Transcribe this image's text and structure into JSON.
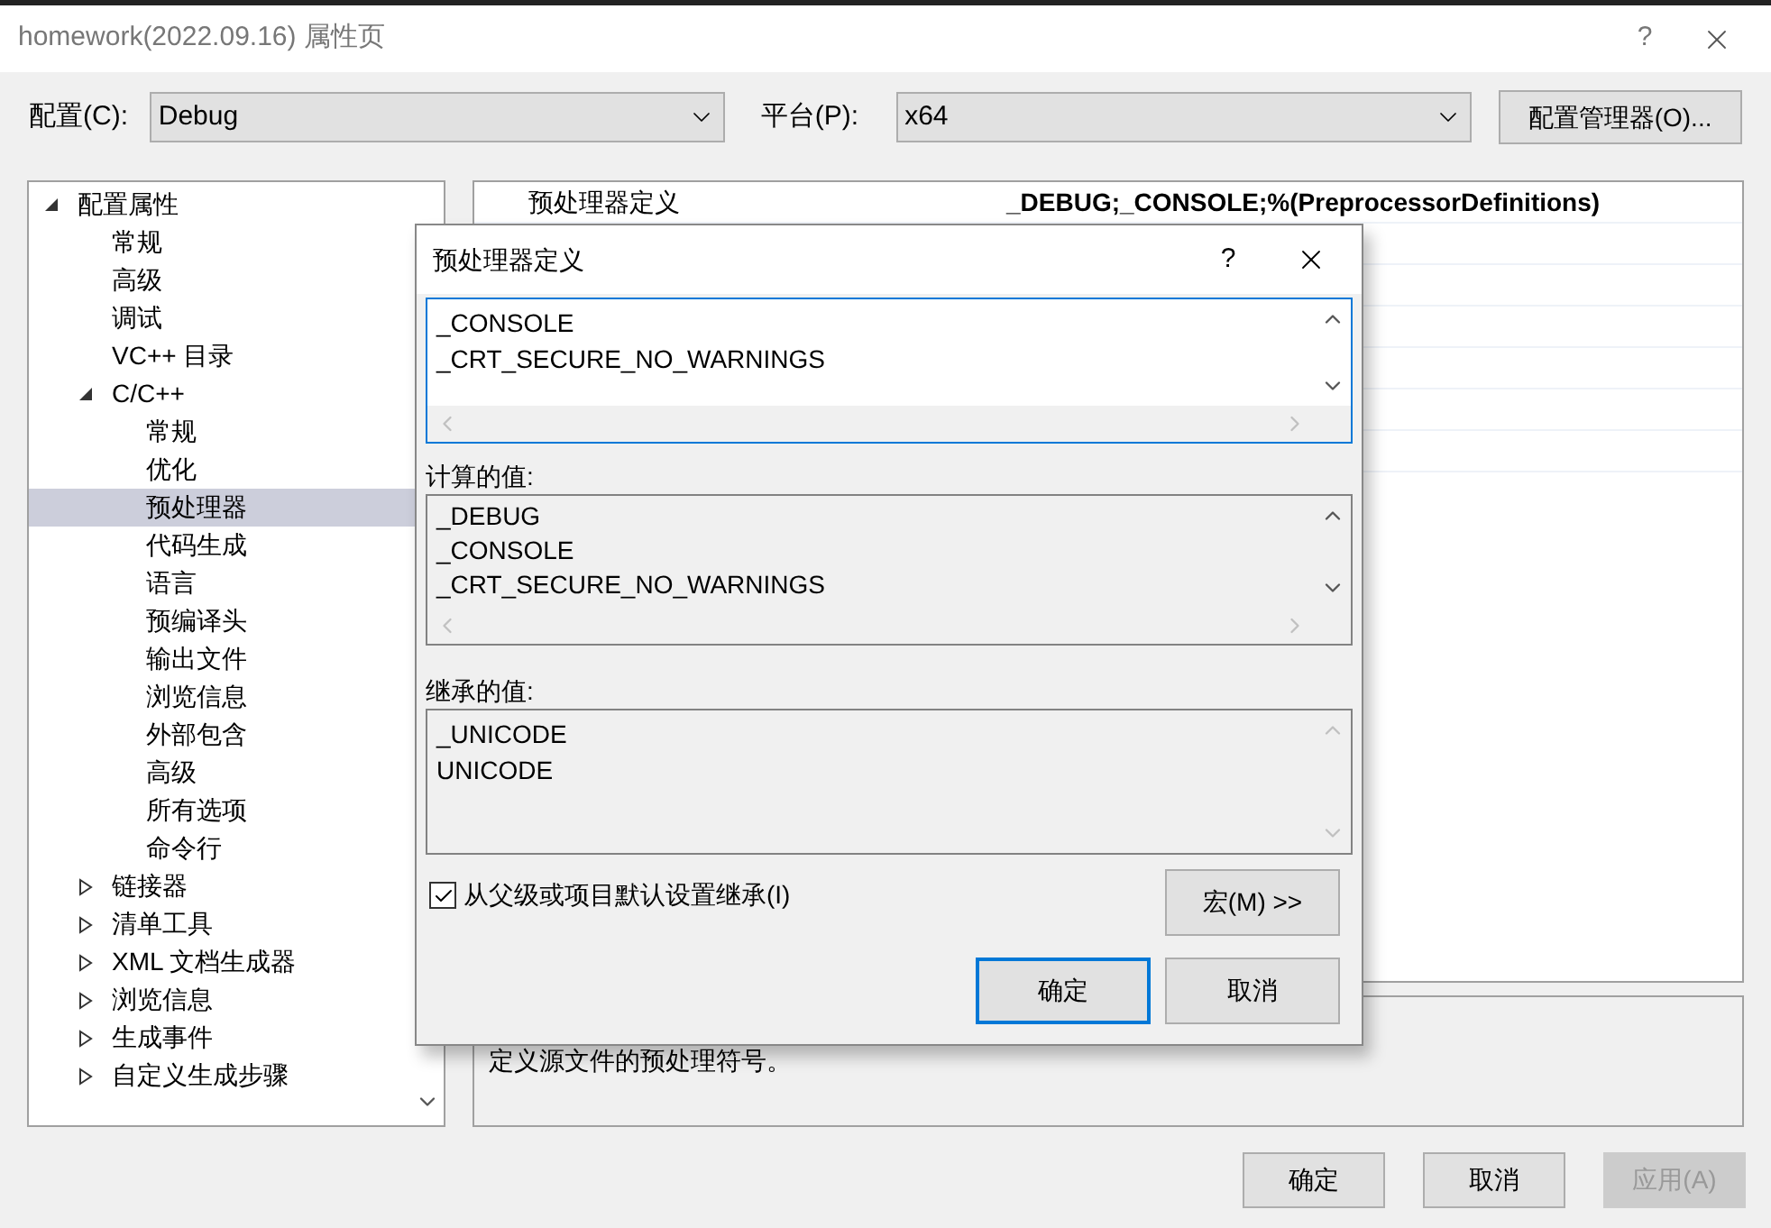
{
  "window": {
    "title": "homework(2022.09.16) 属性页",
    "help": "?"
  },
  "config": {
    "label": "配置(C):",
    "value": "Debug"
  },
  "platform": {
    "label": "平台(P):",
    "value": "x64"
  },
  "config_manager": "配置管理器(O)...",
  "tree": [
    {
      "label": "配置属性",
      "expanded": true,
      "selected": false,
      "children": [
        {
          "label": "常规",
          "selected": false
        },
        {
          "label": "高级",
          "selected": false
        },
        {
          "label": "调试",
          "selected": false
        },
        {
          "label": "VC++ 目录",
          "selected": false
        },
        {
          "label": "C/C++",
          "expanded": true,
          "selected": false,
          "children": [
            {
              "label": "常规",
              "selected": false
            },
            {
              "label": "优化",
              "selected": false
            },
            {
              "label": "预处理器",
              "selected": true
            },
            {
              "label": "代码生成",
              "selected": false
            },
            {
              "label": "语言",
              "selected": false
            },
            {
              "label": "预编译头",
              "selected": false
            },
            {
              "label": "输出文件",
              "selected": false
            },
            {
              "label": "浏览信息",
              "selected": false
            },
            {
              "label": "外部包含",
              "selected": false
            },
            {
              "label": "高级",
              "selected": false
            },
            {
              "label": "所有选项",
              "selected": false
            },
            {
              "label": "命令行",
              "selected": false
            }
          ]
        },
        {
          "label": "链接器",
          "expanded": false,
          "selected": false
        },
        {
          "label": "清单工具",
          "expanded": false,
          "selected": false
        },
        {
          "label": "XML 文档生成器",
          "expanded": false,
          "selected": false
        },
        {
          "label": "浏览信息",
          "expanded": false,
          "selected": false
        },
        {
          "label": "生成事件",
          "expanded": false,
          "selected": false
        },
        {
          "label": "自定义生成步骤",
          "expanded": false,
          "selected": false
        }
      ]
    }
  ],
  "grid": {
    "rows": [
      {
        "name": "预处理器定义",
        "value": "_DEBUG;_CONSOLE;%(PreprocessorDefinitions)"
      }
    ]
  },
  "description": "定义源文件的预处理符号。",
  "buttons": [
    {
      "label": "确定",
      "disabled": false
    },
    {
      "label": "取消",
      "disabled": false
    },
    {
      "label": "应用(A)",
      "disabled": true
    }
  ],
  "dialog": {
    "title": "预处理器定义",
    "help": "?",
    "definitions": [
      "_CONSOLE",
      "_CRT_SECURE_NO_WARNINGS"
    ],
    "evaluated_label": "计算的值:",
    "evaluated": [
      "_DEBUG",
      "_CONSOLE",
      "_CRT_SECURE_NO_WARNINGS"
    ],
    "inherited_label": "继承的值:",
    "inherited": [
      "_UNICODE",
      "UNICODE"
    ],
    "inherit": {
      "label": "从父级或项目默认设置继承(I)",
      "checked": true
    },
    "macros": "宏(M) >>",
    "buttons": [
      {
        "label": "确定",
        "default": true
      },
      {
        "label": "取消",
        "default": false
      }
    ]
  }
}
